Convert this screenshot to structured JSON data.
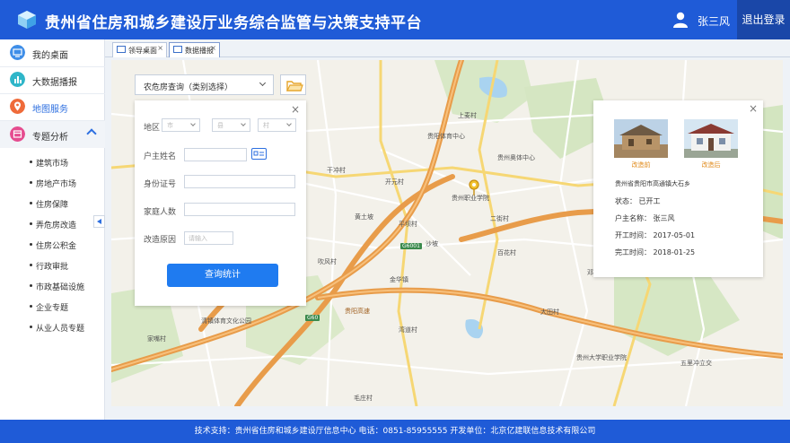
{
  "header": {
    "title": "贵州省住房和城乡建设厅业务综合监管与决策支持平台",
    "user_name": "张三风",
    "logout_label": "退出登录",
    "accent_color": "#1f5bd7"
  },
  "sidebar": {
    "items": [
      {
        "label": "我的桌面",
        "icon": "monitor-icon",
        "color": "#3f8ee8"
      },
      {
        "label": "大数据播报",
        "icon": "chart-icon",
        "color": "#2fb6c9"
      },
      {
        "label": "地图服务",
        "icon": "map-pin-icon",
        "color": "#ef6b3a",
        "active": true
      },
      {
        "label": "专题分析",
        "icon": "calendar-icon",
        "color": "#e54c8f",
        "expanded": true
      }
    ],
    "sub_items": [
      "建筑市场",
      "房地产市场",
      "住房保障",
      "弄危房改造",
      "住房公积金",
      "行政审批",
      "市政基础设施",
      "企业专题",
      "从业人员专题"
    ]
  },
  "tabs": [
    {
      "label": "领导桌面",
      "close": "×"
    },
    {
      "label": "数据播报",
      "close": "×"
    }
  ],
  "map": {
    "labels": [
      "上麦村",
      "贵州奥体中心",
      "贵阳体育中心",
      "开元村",
      "贵州职业学院",
      "黄土坡",
      "二街村",
      "平坝村",
      "干冲村",
      "吹风村",
      "沙坡",
      "百花村",
      "金华镇",
      "湾道村",
      "清镇体育文化公园",
      "家嘴村",
      "G60",
      "G6001",
      "贵阳高速",
      "贵州大学职业学院",
      "五里冲立交",
      "大田村",
      "邓家村",
      "毛庄村",
      "上麦"
    ],
    "query_select": "农危房查询（类别选择）"
  },
  "query_panel": {
    "close": "×",
    "region_label": "地区",
    "region_city": "市",
    "region_county": "县",
    "region_village": "村",
    "owner_label": "户主姓名",
    "id_label": "身份证号",
    "family_label": "家庭人数",
    "reason_label": "改造原因",
    "reason_placeholder": "请输入",
    "submit_label": "查询统计"
  },
  "info_card": {
    "close": "×",
    "before_caption": "改造前",
    "after_caption": "改造后",
    "address": "贵州省贵阳市高通镇大石乡",
    "status": "状态：  已开工",
    "owner": "户主名称：  张三风",
    "start": "开工时间：  2017-05-01",
    "finish": "完工时间：  2018-01-25"
  },
  "footer": {
    "text": "技术支持：贵州省住房和城乡建设厅信息中心  电话：0851-85955555  开发单位：北京亿建联信息技术有限公司"
  }
}
